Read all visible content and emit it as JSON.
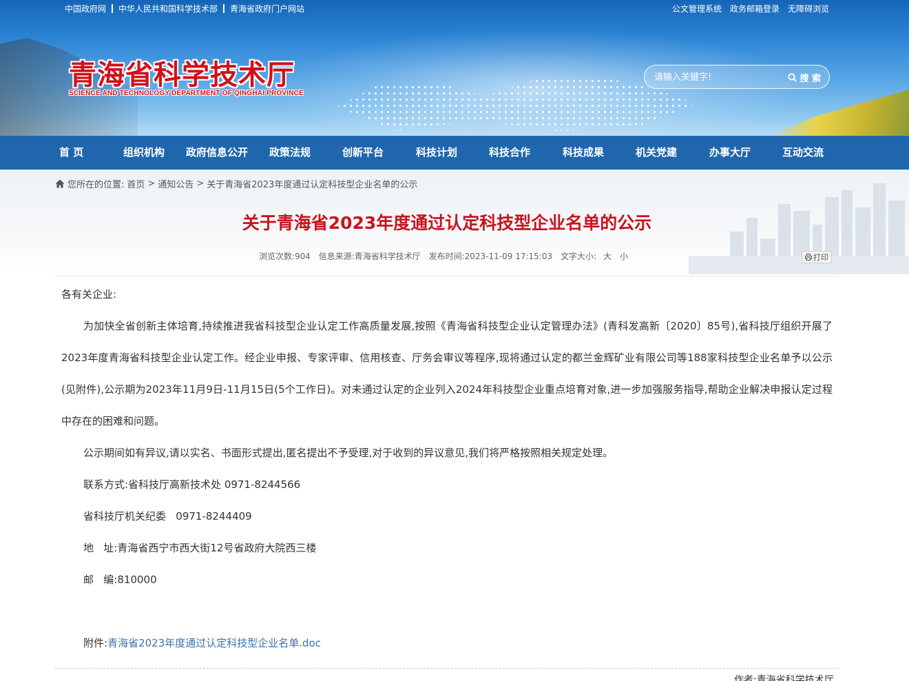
{
  "top_links": [
    "中国政府网",
    "中华人民共和国科学技术部",
    "青海省政府门户网站"
  ],
  "top_right_links": [
    "公文管理系统",
    "政务邮箱登录",
    "无障碍浏览"
  ],
  "logo": {
    "cn": "青海省科学技术厅",
    "en": "SCIENCE AND TECHNOLOGY DEPARTMENT OF QINGHAI PROVINCE"
  },
  "search": {
    "placeholder": "请输入关键字!",
    "button_label": "搜 索",
    "icon": "search-icon"
  },
  "nav": [
    "首 页",
    "组织机构",
    "政府信息公开",
    "政策法规",
    "创新平台",
    "科技计划",
    "科技合作",
    "科技成果",
    "机关党建",
    "办事大厅",
    "互动交流"
  ],
  "breadcrumb": {
    "icon": "home-icon",
    "prefix": "您所在的位置:",
    "items": [
      "首页",
      "通知公告",
      "关于青海省2023年度通过认定科技型企业名单的公示"
    ],
    "separator": ">"
  },
  "article": {
    "title": "关于青海省2023年度通过认定科技型企业名单的公示",
    "meta": {
      "views": "浏览次数:904",
      "source": "信息来源:青海省科学技术厅",
      "published": "发布时间:2023-11-09 17:15:03",
      "font_size_label": "文字大小:",
      "size_large": "大",
      "size_small": "小"
    },
    "print_label": "打印",
    "salutation": "各有关企业:",
    "paragraphs": [
      "为加快全省创新主体培育,持续推进我省科技型企业认定工作高质量发展,按照《青海省科技型企业认定管理办法》(青科发高新〔2020〕85号),省科技厅组织开展了2023年度青海省科技型企业认定工作。经企业申报、专家评审、信用核查、厅务会审议等程序,现将通过认定的都兰金辉矿业有限公司等188家科技型企业名单予以公示(见附件),公示期为2023年11月9日-11月15日(5个工作日)。对未通过认定的企业列入2024年科技型企业重点培育对象,进一步加强服务指导,帮助企业解决申报认定过程中存在的困难和问题。",
      "公示期间如有异议,请以实名、书面形式提出,匿名提出不予受理,对于收到的异议意见,我们将严格按照相关规定处理。"
    ],
    "contacts": [
      "联系方式:省科技厅高新技术处 0971-8244566",
      "省科技厅机关纪委   0971-8244409",
      "地   址:青海省西宁市西大街12号省政府大院西三楼",
      "邮   编:810000"
    ],
    "attachment_label": "附件:",
    "attachment_name": "青海省2023年度通过认定科技型企业名单.doc",
    "author": "作者:青海省科学技术厅"
  },
  "colors": {
    "nav_bg": "#1f66ad",
    "title_red": "#c8141d",
    "link_blue": "#3a73b0"
  }
}
